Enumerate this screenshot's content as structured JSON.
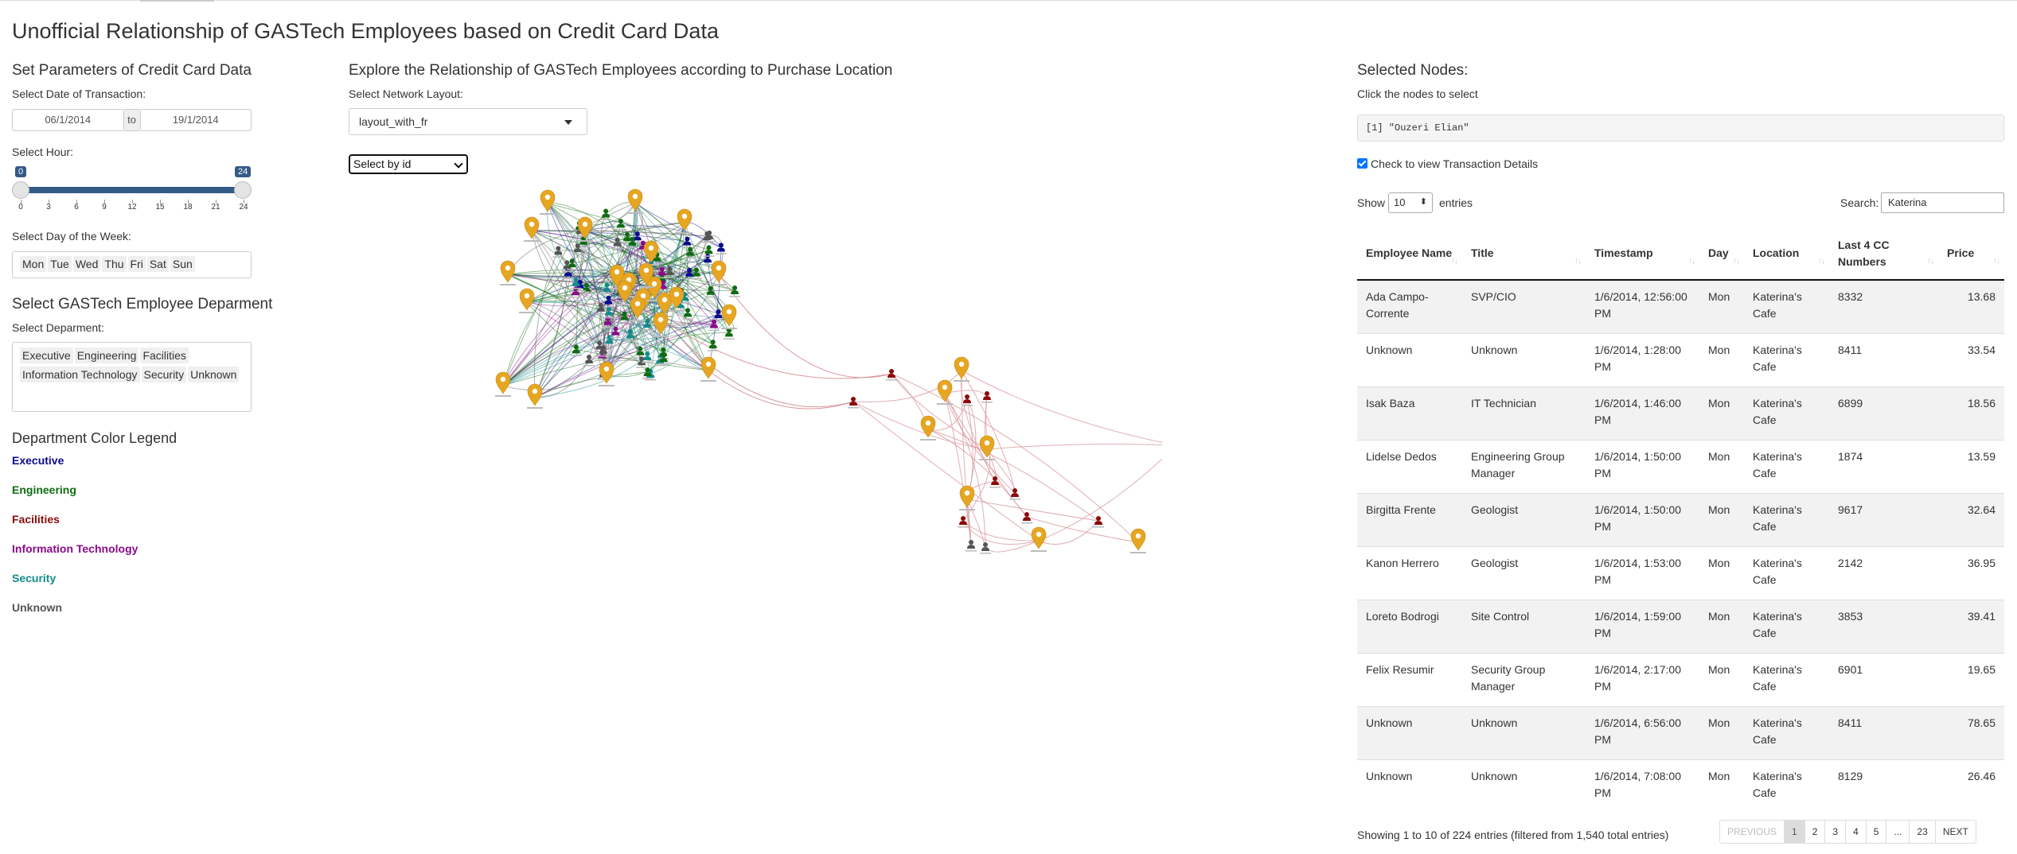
{
  "app_title": "Unofficial Relationship of GASTech Employees based on Credit Card Data",
  "params": {
    "heading": "Set Parameters of Credit Card Data",
    "date_label": "Select Date of Transaction:",
    "date_start": "06/1/2014",
    "date_to": "to",
    "date_end": "19/1/2014",
    "hour_label": "Select Hour:",
    "hour_min": "0",
    "hour_max": "24",
    "hour_ticks": [
      "0",
      "3",
      "6",
      "9",
      "12",
      "15",
      "18",
      "21",
      "24"
    ],
    "dow_label": "Select Day of the Week:",
    "days": [
      "Mon",
      "Tue",
      "Wed",
      "Thu",
      "Fri",
      "Sat",
      "Sun"
    ]
  },
  "department": {
    "heading": "Select GASTech Employee Deparment",
    "label": "Select Deparment:",
    "chips": [
      "Executive",
      "Engineering",
      "Facilities",
      "Information Technology",
      "Security",
      "Unknown"
    ]
  },
  "legend": {
    "heading": "Department Color Legend",
    "items": [
      {
        "label": "Executive",
        "color": "#0b0b8c"
      },
      {
        "label": "Engineering",
        "color": "#0f6b12"
      },
      {
        "label": "Facilities",
        "color": "#8b0a0a"
      },
      {
        "label": "Information Technology",
        "color": "#8a0a8a"
      },
      {
        "label": "Security",
        "color": "#128b8b"
      },
      {
        "label": "Unknown",
        "color": "#555555"
      }
    ]
  },
  "network": {
    "heading": "Explore the Relationship of GASTech Employees according to Purchase Location",
    "layout_label": "Select Network Layout:",
    "layout_value": "layout_with_fr",
    "id_select": "Select by id"
  },
  "selected": {
    "heading": "Selected Nodes:",
    "hint": "Click the nodes to select",
    "output": "[1] \"Ouzeri Elian\"",
    "checkbox_label": "Check to view Transaction Details"
  },
  "table": {
    "show": "Show",
    "entries_value": "10",
    "entries": "entries",
    "search_label": "Search:",
    "search_value": "Katerina",
    "headers": [
      "Employee Name",
      "Title",
      "Timestamp",
      "Day",
      "Location",
      "Last 4 CC Numbers",
      "Price"
    ],
    "rows": [
      [
        "Ada Campo-Corrente",
        "SVP/CIO",
        "1/6/2014, 12:56:00 PM",
        "Mon",
        "Katerina's Cafe",
        "8332",
        "13.68"
      ],
      [
        "Unknown",
        "Unknown",
        "1/6/2014, 1:28:00 PM",
        "Mon",
        "Katerina's Cafe",
        "8411",
        "33.54"
      ],
      [
        "Isak Baza",
        "IT Technician",
        "1/6/2014, 1:46:00 PM",
        "Mon",
        "Katerina's Cafe",
        "6899",
        "18.56"
      ],
      [
        "Lidelse Dedos",
        "Engineering Group Manager",
        "1/6/2014, 1:50:00 PM",
        "Mon",
        "Katerina's Cafe",
        "1874",
        "13.59"
      ],
      [
        "Birgitta Frente",
        "Geologist",
        "1/6/2014, 1:50:00 PM",
        "Mon",
        "Katerina's Cafe",
        "9617",
        "32.64"
      ],
      [
        "Kanon Herrero",
        "Geologist",
        "1/6/2014, 1:53:00 PM",
        "Mon",
        "Katerina's Cafe",
        "2142",
        "36.95"
      ],
      [
        "Loreto Bodrogi",
        "Site Control",
        "1/6/2014, 1:59:00 PM",
        "Mon",
        "Katerina's Cafe",
        "3853",
        "39.41"
      ],
      [
        "Felix Resumir",
        "Security Group Manager",
        "1/6/2014, 2:17:00 PM",
        "Mon",
        "Katerina's Cafe",
        "6901",
        "19.65"
      ],
      [
        "Unknown",
        "Unknown",
        "1/6/2014, 6:56:00 PM",
        "Mon",
        "Katerina's Cafe",
        "8411",
        "78.65"
      ],
      [
        "Unknown",
        "Unknown",
        "1/6/2014, 7:08:00 PM",
        "Mon",
        "Katerina's Cafe",
        "8129",
        "26.46"
      ]
    ],
    "info": "Showing 1 to 10 of 224 entries (filtered from 1,540 total entries)",
    "pager": [
      "PREVIOUS",
      "1",
      "2",
      "3",
      "4",
      "5",
      "...",
      "23",
      "NEXT"
    ]
  }
}
